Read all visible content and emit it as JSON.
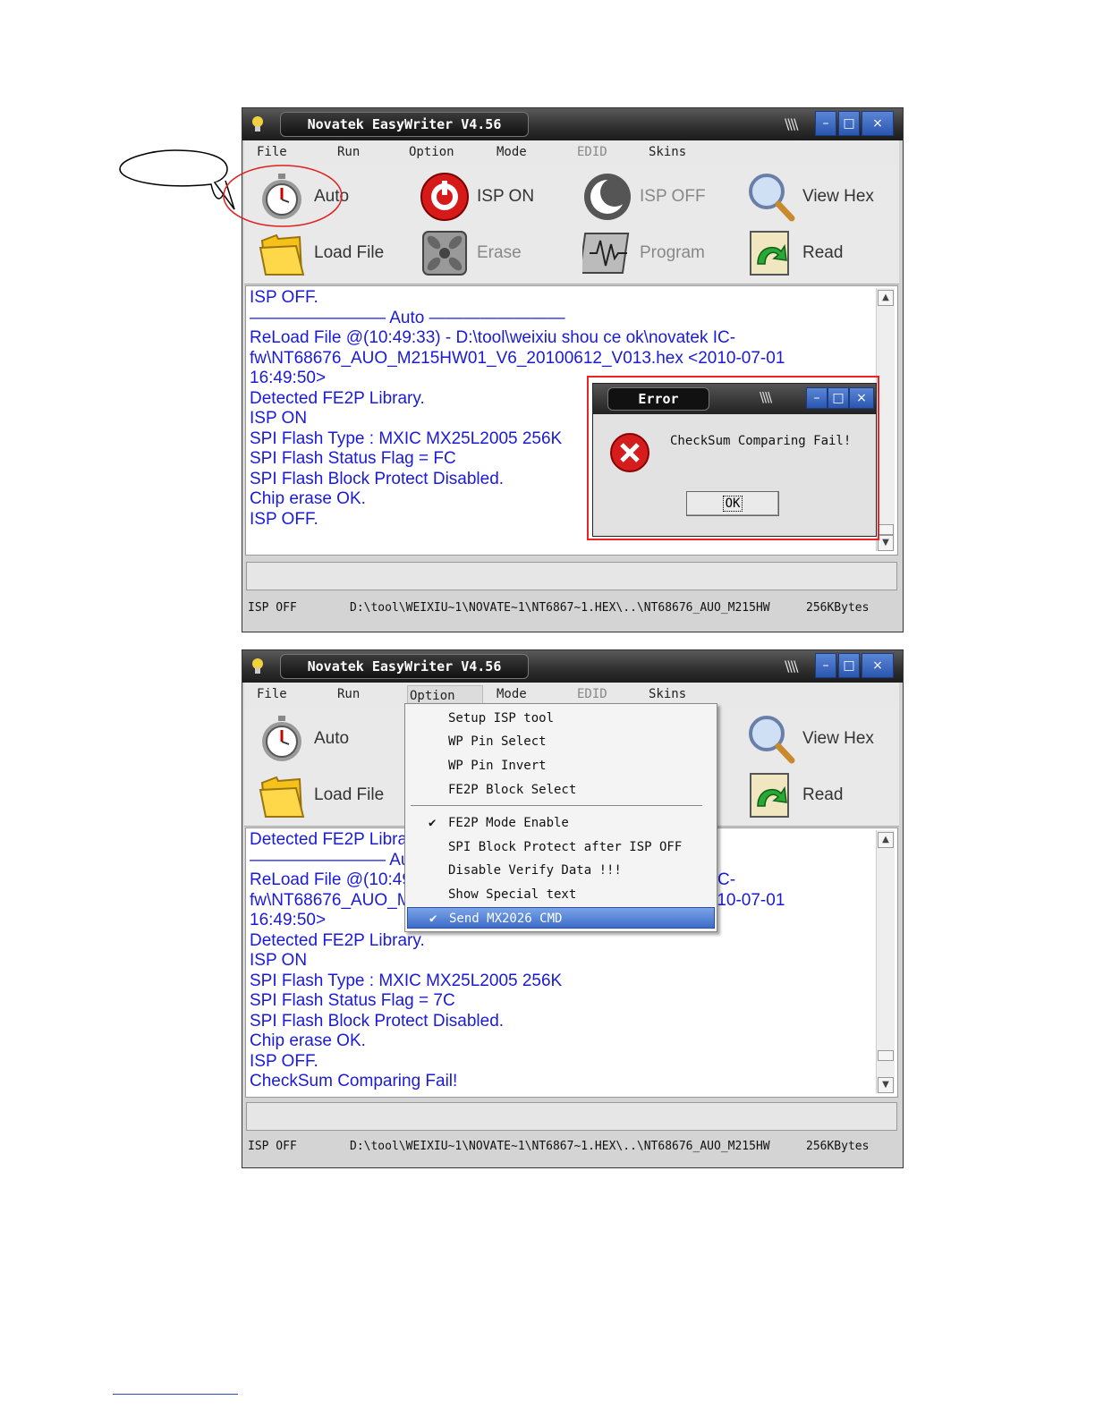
{
  "window1": {
    "title": "Novatek EasyWriter V4.56",
    "menu": [
      "File",
      "Run",
      "Option",
      "Mode",
      "EDID",
      "Skins"
    ],
    "tools": [
      "Auto",
      "ISP ON",
      "ISP OFF",
      "View Hex",
      "Load File",
      "Erase",
      "Program",
      "Read"
    ],
    "log": [
      "ISP OFF.",
      "———————— Auto ————————",
      "ReLoad File @(10:49:33) - D:\\tool\\weixiu shou ce ok\\novatek IC-",
      "fw\\NT68676_AUO_M215HW01_V6_20100612_V013.hex <2010-07-01",
      "16:49:50>",
      "Detected FE2P Library.",
      "ISP ON",
      "SPI Flash Type : MXIC MX25L2005 256K",
      "SPI Flash Status Flag = FC",
      "SPI Flash Block Protect Disabled.",
      "Chip erase OK.",
      "ISP OFF."
    ],
    "status": {
      "state": "ISP OFF",
      "path": "D:\\tool\\WEIXIU~1\\NOVATE~1\\NT6867~1.HEX\\..\\NT68676_AUO_M215HW",
      "size": "256KBytes"
    },
    "error_dialog": {
      "title": "Error",
      "message": "CheckSum Comparing Fail!",
      "ok": "OK"
    }
  },
  "window2": {
    "title": "Novatek EasyWriter V4.56",
    "menu": [
      "File",
      "Run",
      "Option",
      "Mode",
      "EDID",
      "Skins"
    ],
    "tools": [
      "Auto",
      "Load File",
      "View Hex",
      "Read"
    ],
    "log": [
      "Detected FE2P Library.",
      "———————— Auto ————————",
      "ReLoad File @(10:49:33) - D:\\tool\\weixiu shou ce ok\\novatek IC-",
      "fw\\NT68676_AUO_M215HW01_V6_20100612_V013.hex <2010-07-01",
      "16:49:50>",
      "Detected FE2P Library.",
      "ISP ON",
      "SPI Flash Type : MXIC MX25L2005 256K",
      "SPI Flash Status Flag = 7C",
      "SPI Flash Block Protect Disabled.",
      "Chip erase OK.",
      "ISP OFF.",
      "CheckSum Comparing Fail!"
    ],
    "status": {
      "state": "ISP OFF",
      "path": "D:\\tool\\WEIXIU~1\\NOVATE~1\\NT6867~1.HEX\\..\\NT68676_AUO_M215HW",
      "size": "256KBytes"
    },
    "option_menu": {
      "items": [
        "Setup ISP tool",
        "WP Pin Select",
        "WP Pin Invert",
        "FE2P Block Select",
        "FE2P Mode Enable",
        "SPI Block Protect after ISP OFF",
        "Disable Verify Data !!!",
        "Show Special text",
        "Send MX2026 CMD"
      ],
      "checked": [
        "FE2P Mode Enable",
        "Send MX2026 CMD"
      ],
      "highlighted": "Send MX2026 CMD"
    }
  },
  "colors": {
    "log_text": "#1a1ad8",
    "annotation_red": "#e02020",
    "menu_highlight": "#3d6cc8",
    "title_button": "#2a56b0"
  },
  "icons": [
    "stopwatch-icon",
    "isp-on-icon",
    "isp-off-icon",
    "magnifier-icon",
    "folder-icon",
    "erase-icon",
    "program-icon",
    "read-icon",
    "error-icon",
    "checkmark-icon",
    "app-lightbulb-icon"
  ]
}
